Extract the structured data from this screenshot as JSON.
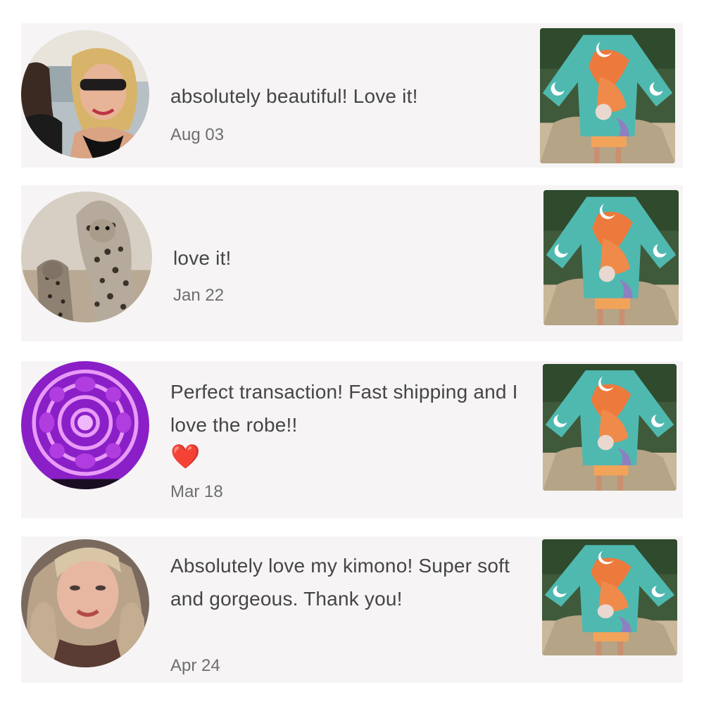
{
  "reviews": [
    {
      "text": "absolutely beautiful! Love it!",
      "date": "Aug 03",
      "avatar": "couple-photo",
      "thumb": "kimono-photo"
    },
    {
      "text": "love it!",
      "date": "Jan 22",
      "avatar": "leopard-photo",
      "thumb": "kimono-photo"
    },
    {
      "text": "Perfect transaction! Fast shipping and I love the robe!!",
      "emoji": "❤️",
      "date": "Mar 18",
      "avatar": "purple-dahlia-photo",
      "thumb": "kimono-photo"
    },
    {
      "text": "Absolutely love my kimono! Super soft and gorgeous. Thank you!",
      "date": "Apr 24",
      "avatar": "woman-portrait-photo",
      "thumb": "kimono-photo"
    }
  ],
  "colors": {
    "card_bg": "#f6f4f5",
    "text": "#454545",
    "date": "#6e6e6e",
    "heart": "#e5202a"
  }
}
